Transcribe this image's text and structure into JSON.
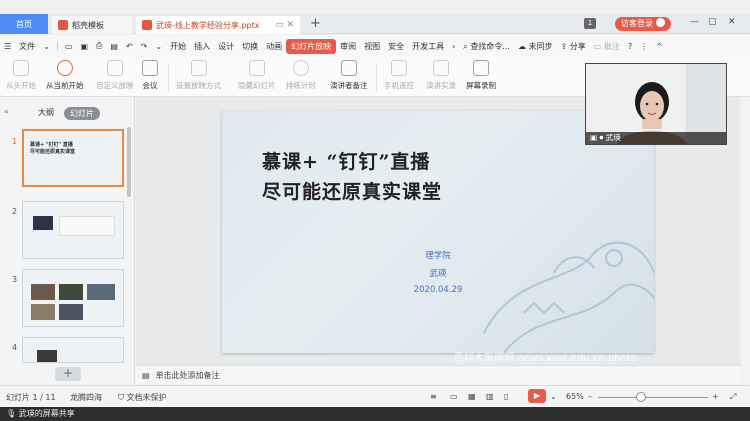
{
  "tabs": {
    "home": "首页",
    "template": "稻壳模板",
    "document": "武瑛-线上教学经验分享.pptx"
  },
  "titlebar": {
    "page_indicator": "1",
    "login": "访客登录"
  },
  "menu": {
    "file": "文件",
    "items": [
      "开始",
      "插入",
      "设计",
      "切换",
      "动画",
      "幻灯片放映",
      "审阅",
      "视图",
      "安全",
      "开发工具"
    ],
    "active_index": 5,
    "search": "查找命令...",
    "sync": "未同步",
    "share": "分享",
    "comment": "批注"
  },
  "ribbon": {
    "buttons": [
      {
        "label": "从头开始",
        "dim": true
      },
      {
        "label": "从当前开始",
        "dim": false
      },
      {
        "label": "自定义放映",
        "dim": true
      },
      {
        "label": "会议",
        "dim": false
      },
      {
        "label": "设置放映方式",
        "dim": true
      },
      {
        "label": "隐藏幻灯片",
        "dim": true
      },
      {
        "label": "排练计时",
        "dim": true
      },
      {
        "label": "演讲者备注",
        "dim": false
      },
      {
        "label": "手机遥控",
        "dim": true
      },
      {
        "label": "演讲实录",
        "dim": true
      },
      {
        "label": "屏幕录制",
        "dim": false
      }
    ]
  },
  "leftpanel": {
    "tab_outline": "大纲",
    "tab_slides": "幻灯片",
    "slide_numbers": [
      "1",
      "2",
      "3",
      "4"
    ]
  },
  "slide": {
    "title_line1": "慕课+ “钉钉”直播",
    "title_line2": "尽可能还原真实课堂",
    "org": "理学院",
    "author": "武瑛",
    "date": "2020.04.29",
    "watermark": "西科大新闻网 news.xust.edu.cn photo"
  },
  "notes": {
    "placeholder": "单击此处添加备注"
  },
  "statusbar": {
    "slide_info": "幻灯片 1 / 11",
    "theme": "龙腾四海",
    "protection": "文档未保护",
    "zoom": "65%"
  },
  "video": {
    "name": "武瑛"
  },
  "sharebar": {
    "text": "武瑛的屏幕共享"
  },
  "colors": {
    "accent": "#e85b4a",
    "home_tab": "#4f8df5"
  }
}
